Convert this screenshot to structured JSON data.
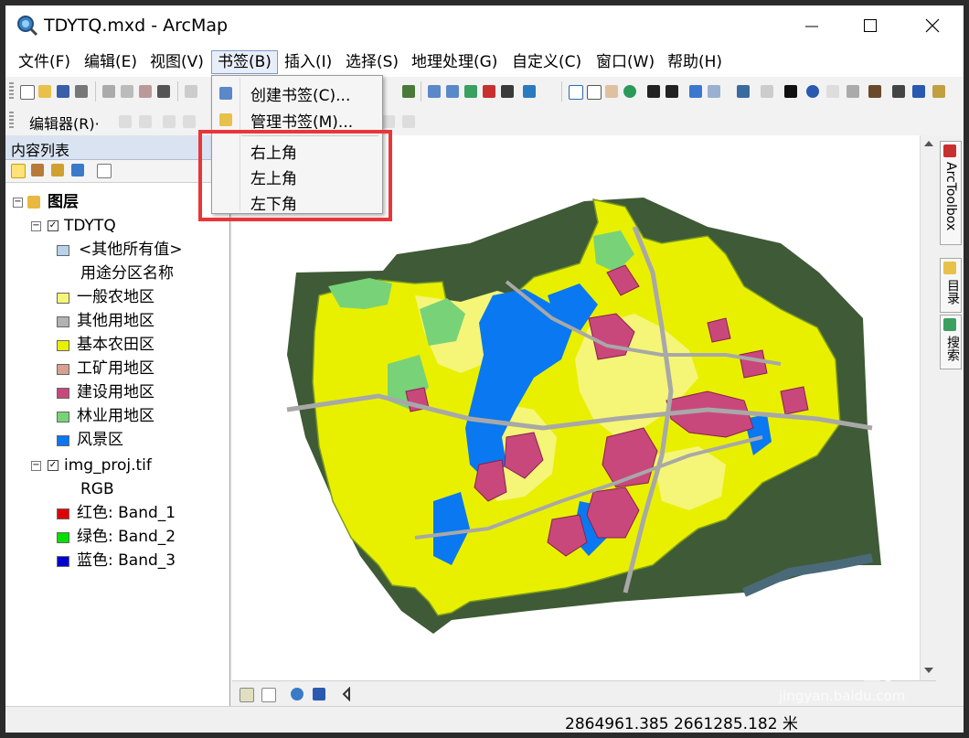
{
  "window": {
    "title": "TDYTQ.mxd - ArcMap"
  },
  "menubar": {
    "items": [
      "文件(F)",
      "编辑(E)",
      "视图(V)",
      "书签(B)",
      "插入(I)",
      "选择(S)",
      "地理处理(G)",
      "自定义(C)",
      "窗口(W)",
      "帮助(H)"
    ]
  },
  "editor_toolbar": {
    "label": "编辑器(R)·"
  },
  "toc": {
    "title": "内容列表",
    "layers_root": "图层",
    "layer1": {
      "name": "TDYTQ",
      "other_values": "<其他所有值>",
      "field_name": "用途分区名称",
      "classes": [
        {
          "label": "一般农地区",
          "color": "#f5f578"
        },
        {
          "label": "其他用地区",
          "color": "#b2b2b2"
        },
        {
          "label": "基本农田区",
          "color": "#e8f000"
        },
        {
          "label": "工矿用地区",
          "color": "#d7a090"
        },
        {
          "label": "建设用地区",
          "color": "#c8487c"
        },
        {
          "label": "林业用地区",
          "color": "#78d278"
        },
        {
          "label": "风景区",
          "color": "#0a78f0"
        }
      ],
      "other_color": "#b9d2ea"
    },
    "layer2": {
      "name": "img_proj.tif",
      "render": "RGB",
      "bands": [
        {
          "label": "红色:   Band_1",
          "color": "#e00000"
        },
        {
          "label": "绿色: Band_2",
          "color": "#00e000"
        },
        {
          "label": "蓝色:   Band_3",
          "color": "#0000d0"
        }
      ]
    }
  },
  "bookmark_menu": {
    "create": "创建书签(C)...",
    "manage": "管理书签(M)...",
    "bookmarks": [
      "右上角",
      "左上角",
      "左下角"
    ]
  },
  "right_tabs": {
    "toolbox": "ArcToolbox",
    "catalog": "目录",
    "search": "搜索"
  },
  "status": {
    "coordinates": "2864961.385  2661285.182 米"
  },
  "watermark": {
    "brand": "Bai",
    "brand_cn": "经验",
    "url": "jingyan.baidu.com"
  },
  "colors": {
    "highlight": "#e8363a",
    "menu_open": "#e8eef8"
  }
}
